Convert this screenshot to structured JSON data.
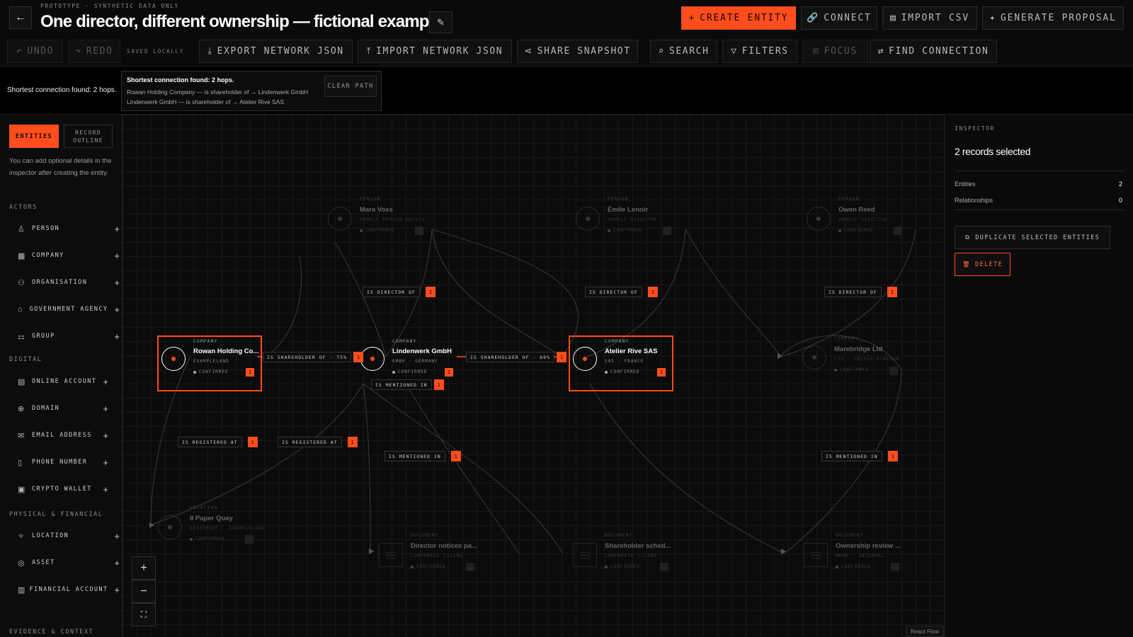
{
  "header": {
    "prototype_label": "PROTOTYPE · SYNTHETIC DATA ONLY",
    "title": "One director, different ownership — fictional example",
    "buttons": {
      "create_entity": "CREATE ENTITY",
      "connect": "CONNECT",
      "import_csv": "IMPORT CSV",
      "generate_proposal": "GENERATE PROPOSAL"
    }
  },
  "toolbar": {
    "undo": "UNDO",
    "redo": "REDO",
    "saved_locally": "SAVED LOCALLY",
    "export_json": "EXPORT NETWORK JSON",
    "import_json": "IMPORT NETWORK JSON",
    "share_snapshot": "SHARE SNAPSHOT",
    "search": "SEARCH",
    "filters": "FILTERS",
    "focus": "FOCUS",
    "find_connection": "FIND CONNECTION"
  },
  "path_banner": {
    "summary": "Shortest connection found: 2 hops.",
    "card_title": "Shortest connection found: 2 hops.",
    "hops": [
      "Rowan Holding Company — is shareholder of → Lindenwerk GmbH",
      "Lindenwerk GmbH — is shareholder of → Atelier Rive SAS"
    ],
    "clear_path": "CLEAR PATH"
  },
  "sidebar": {
    "tabs": {
      "entities": "ENTITIES",
      "record_outline": "RECORD OUTLINE"
    },
    "hint": "You can add optional details in the inspector after creating the entity.",
    "groups": [
      {
        "label": "ACTORS",
        "items": [
          "PERSON",
          "COMPANY",
          "ORGANISATION",
          "GOVERNMENT AGENCY",
          "GROUP"
        ]
      },
      {
        "label": "DIGITAL",
        "items": [
          "ONLINE ACCOUNT",
          "DOMAIN",
          "EMAIL ADDRESS",
          "PHONE NUMBER",
          "CRYPTO WALLET"
        ]
      },
      {
        "label": "PHYSICAL & FINANCIAL",
        "items": [
          "LOCATION",
          "ASSET",
          "FINANCIAL ACCOUNT"
        ]
      },
      {
        "label": "EVIDENCE & CONTEXT",
        "items": []
      }
    ]
  },
  "canvas": {
    "nodes": {
      "mara": {
        "type": "PERSON",
        "name": "Mara Voss",
        "sub": "SAMPLE PERSON ENTITY",
        "status": "CONFIRMED",
        "count": "1"
      },
      "emile": {
        "type": "PERSON",
        "name": "Émile Lenoir",
        "sub": "SAMPLE DIRECTOR",
        "status": "CONFIRMED",
        "count": "1"
      },
      "owen": {
        "type": "PERSON",
        "name": "Owen Reed",
        "sub": "SAMPLE DIRECTOR",
        "status": "CONFIRMED",
        "count": "1"
      },
      "rowan": {
        "type": "COMPANY",
        "name": "Rowan Holding Co...",
        "sub": "EXAMPLELAND",
        "status": "CONFIRMED",
        "count": "1"
      },
      "linden": {
        "type": "COMPANY",
        "name": "Lindenwerk GmbH",
        "sub": "GMBH · GERMANY",
        "status": "CONFIRMED",
        "count": "1"
      },
      "atelier": {
        "type": "COMPANY",
        "name": "Atelier Rive SAS",
        "sub": "SAS · FRANCE",
        "status": "CONFIRMED",
        "count": "1"
      },
      "mare": {
        "type": "COMPANY",
        "name": "Marebridge Ltd",
        "sub": "LTD · UNITED KINGDOM",
        "status": "CONFIRMED",
        "count": "1"
      },
      "quay": {
        "type": "LOCATION",
        "name": "8 Paper Quay",
        "sub": "NORTHPORT · EXAMPLELAND",
        "status": "CONFIRMED",
        "count": "1"
      },
      "doc1": {
        "type": "DOCUMENT",
        "name": "Director notices pa...",
        "sub": "CORPORATE FILING",
        "status": "CONFIRMED",
        "count": "1"
      },
      "doc2": {
        "type": "DOCUMENT",
        "name": "Shareholder sched...",
        "sub": "CORPORATE FILING",
        "status": "CONFIRMED",
        "count": "1"
      },
      "doc3": {
        "type": "DOCUMENT",
        "name": "Ownership review ...",
        "sub": "MEMO · INTERNAL",
        "status": "CONFIRMED",
        "count": "1"
      }
    },
    "edge_labels": [
      {
        "text": "IS DIRECTOR OF",
        "count": "1"
      },
      {
        "text": "IS DIRECTOR OF",
        "count": "1"
      },
      {
        "text": "IS DIRECTOR OF",
        "count": "1"
      },
      {
        "text": "IS SHAREHOLDER OF · 75%",
        "count": "1"
      },
      {
        "text": "IS SHAREHOLDER OF · 60%",
        "count": "1"
      },
      {
        "text": "IS MENTIONED IN",
        "count": "1"
      },
      {
        "text": "IS REGISTERED AT",
        "count": "1"
      },
      {
        "text": "IS REGISTERED AT",
        "count": "1"
      },
      {
        "text": "IS MENTIONED IN",
        "count": "1"
      },
      {
        "text": "IS MENTIONED IN",
        "count": "1"
      }
    ],
    "attribution": "React Flow"
  },
  "inspector": {
    "label": "INSPECTOR",
    "heading": "2 records selected",
    "entities_label": "Entities",
    "entities_value": "2",
    "relationships_label": "Relationships",
    "relationships_value": "0",
    "duplicate_btn": "DUPLICATE SELECTED ENTITIES",
    "delete_btn": "DELETE"
  },
  "colors": {
    "accent": "#ff4d1c",
    "background": "#0a0a0a"
  }
}
